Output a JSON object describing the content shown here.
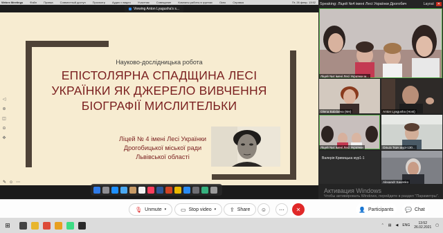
{
  "menubar": {
    "app": "Webex Meetings",
    "items": [
      "Файл",
      "Правка",
      "Совместный доступ",
      "Просмотр",
      "Аудио и видео",
      "Участник",
      "Совещание",
      "Комнаты работы в группах",
      "Окно",
      "Справка"
    ],
    "datetime": "Пт, 26 февр. 13:52"
  },
  "viewing": {
    "label": "Viewing Anton Lyagusha's s..."
  },
  "slide": {
    "subtitle": "Науково-дослідницька робота",
    "title_lines": [
      "ЕПІСТОЛЯРНА СПАДЩИНА ЛЕСІ",
      "УКРАЇНКИ ЯК ДЖЕРЕЛО ВИВЧЕННЯ",
      "БІОГРАФІЇ МИСЛИТЕЛЬКИ"
    ],
    "school_lines": [
      "Ліцей № 4 імені Лесі Українки",
      "Дрогобицької міської ради",
      "Львівської області"
    ]
  },
  "panel": {
    "speaking": "Speaking: Ліцей №4 імені Лесі Українки Дрогобич",
    "layout": "Layout",
    "tiles": [
      {
        "label": "Ліцей №4 імені Лесі Українки м..."
      },
      {
        "label": "Olena Balalaeva (Me)"
      },
      {
        "label": "Anton Lyagusha (Host)"
      },
      {
        "label": "Ліцей №4 імені Лесі Українки"
      },
      {
        "label": "Ольга Ткач журі-130..."
      },
      {
        "label": "Валерія Кривицька жур1-1"
      },
      {
        "label": "Alexandr Savenko"
      }
    ]
  },
  "watermark": {
    "title": "Активация Windows",
    "text": "Чтобы активировать Windows, перейдите в раздел \"Параметры\"."
  },
  "controls": {
    "unmute": "Unmute",
    "stop_video": "Stop video",
    "share": "Share",
    "participants": "Participants",
    "chat": "Chat"
  },
  "taskbar": {
    "lang": "ENG",
    "time": "13:52",
    "date": "26.02.2021"
  },
  "colors": {
    "slide_bg": "#f7ecd1",
    "frame": "#4e4237",
    "title": "#7a1f1f",
    "end_button": "#e02828",
    "active_tile": "#58b04a"
  }
}
